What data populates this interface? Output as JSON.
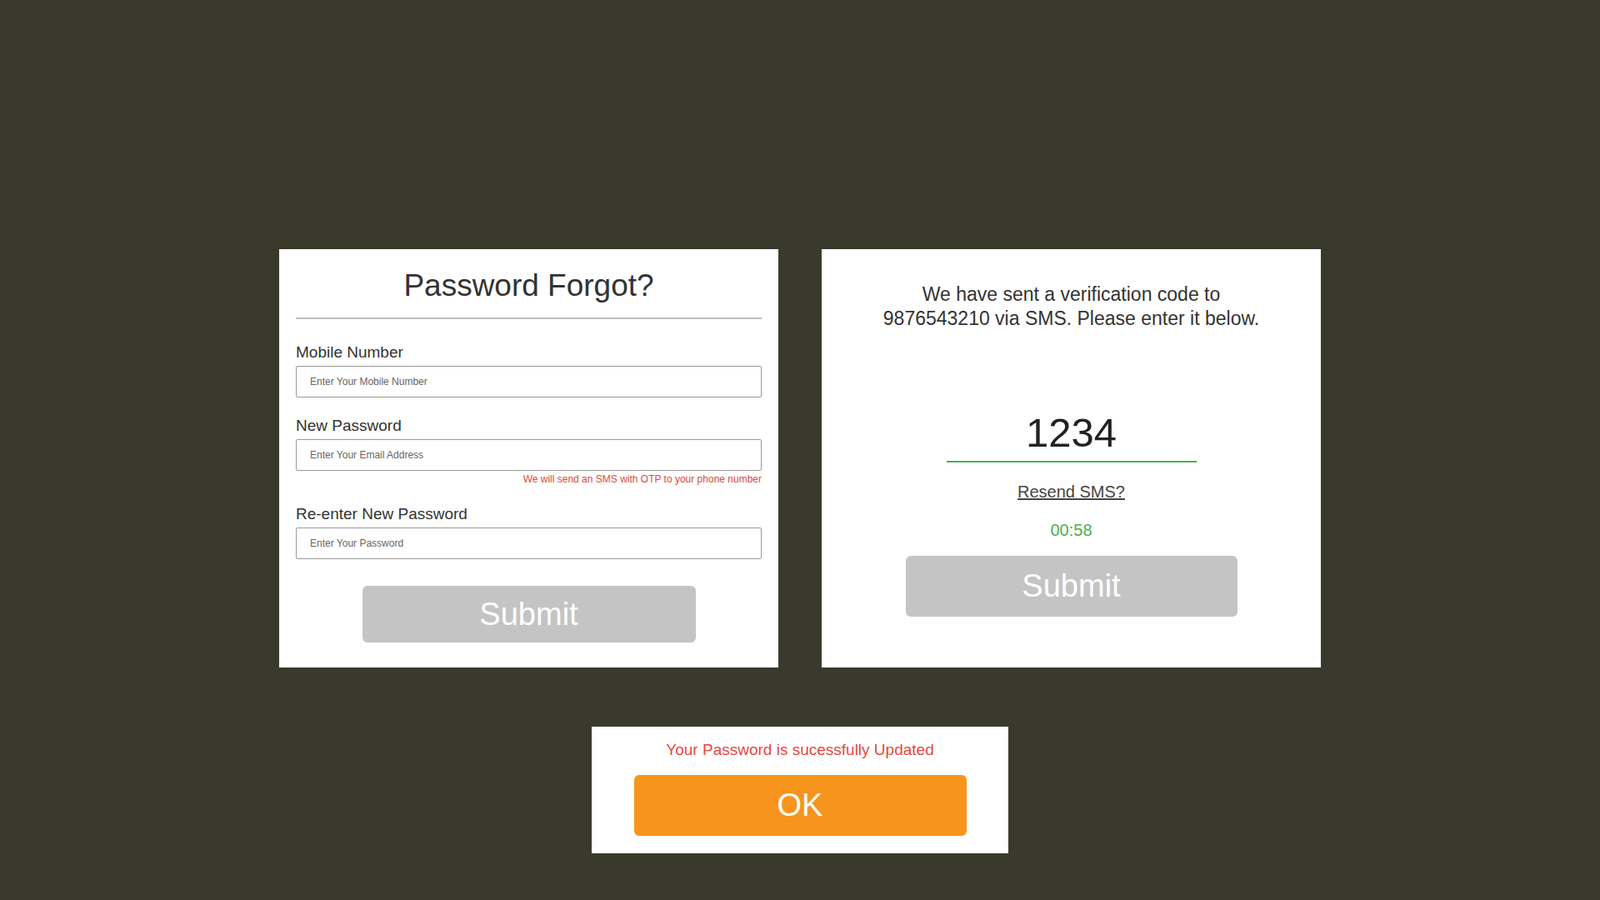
{
  "password_forgot_form": {
    "title": "Password Forgot?",
    "fields": [
      {
        "label": "Mobile Number",
        "placeholder": "Enter Your Mobile Number"
      },
      {
        "label": "New Password",
        "placeholder": "Enter Your Email Address",
        "note": "We will send an SMS with OTP to your phone number"
      },
      {
        "label": "Re-enter New Password",
        "placeholder": "Enter Your Password"
      }
    ],
    "submit": "Submit"
  },
  "verification": {
    "message_lines": [
      "We have sent a verification code to",
      "9876543210 via SMS. Please enter it below."
    ],
    "code": "1234",
    "resend": "Resend SMS?",
    "timer": "00:58",
    "submit": "Submit"
  },
  "success_dialog": {
    "message": "Your Password is sucessfully Updated",
    "button": "OK"
  }
}
